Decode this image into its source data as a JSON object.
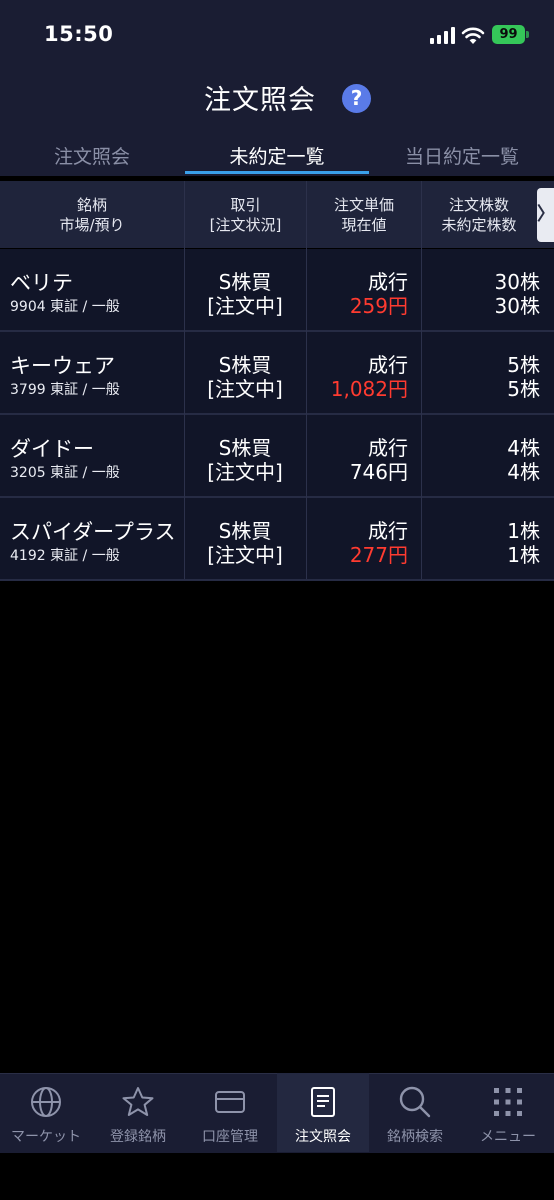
{
  "status_bar": {
    "time": "15:50",
    "battery": "99"
  },
  "header": {
    "title": "注文照会"
  },
  "tabs": [
    {
      "label": "注文照会"
    },
    {
      "label": "未約定一覧"
    },
    {
      "label": "当日約定一覧"
    }
  ],
  "columns": {
    "c1": [
      "銘柄",
      "市場/預り"
    ],
    "c2": [
      "取引",
      "[注文状況]"
    ],
    "c3": [
      "注文単価",
      "現在値"
    ],
    "c4": [
      "注文株数",
      "未約定株数"
    ],
    "more": "〉"
  },
  "rows": [
    {
      "name": "ベリテ",
      "market": "9904 東証 / 一般",
      "trade": "S株買",
      "status": "[注文中]",
      "order_price": "成行",
      "current_price": "259円",
      "price_color": "#ff3b30",
      "order_qty": "30株",
      "open_qty": "30株"
    },
    {
      "name": "キーウェア",
      "market": "3799 東証 / 一般",
      "trade": "S株買",
      "status": "[注文中]",
      "order_price": "成行",
      "current_price": "1,082円",
      "price_color": "#ff3b30",
      "order_qty": "5株",
      "open_qty": "5株"
    },
    {
      "name": "ダイドー",
      "market": "3205 東証 / 一般",
      "trade": "S株買",
      "status": "[注文中]",
      "order_price": "成行",
      "current_price": "746円",
      "price_color": "#ffffff",
      "order_qty": "4株",
      "open_qty": "4株"
    },
    {
      "name": "スパイダープラス",
      "market": "4192 東証 / 一般",
      "trade": "S株買",
      "status": "[注文中]",
      "order_price": "成行",
      "current_price": "277円",
      "price_color": "#ff3b30",
      "order_qty": "1株",
      "open_qty": "1株"
    }
  ],
  "tabbar": [
    {
      "label": "マーケット",
      "icon": "globe-icon"
    },
    {
      "label": "登録銘柄",
      "icon": "star-icon"
    },
    {
      "label": "口座管理",
      "icon": "card-icon"
    },
    {
      "label": "注文照会",
      "icon": "document-icon"
    },
    {
      "label": "銘柄検索",
      "icon": "search-icon"
    },
    {
      "label": "メニュー",
      "icon": "grid-menu-icon"
    }
  ],
  "colors": {
    "accent": "#3aa0ea",
    "up_price": "#ff3b30",
    "help": "#5a7be8",
    "battery": "#35c759"
  }
}
